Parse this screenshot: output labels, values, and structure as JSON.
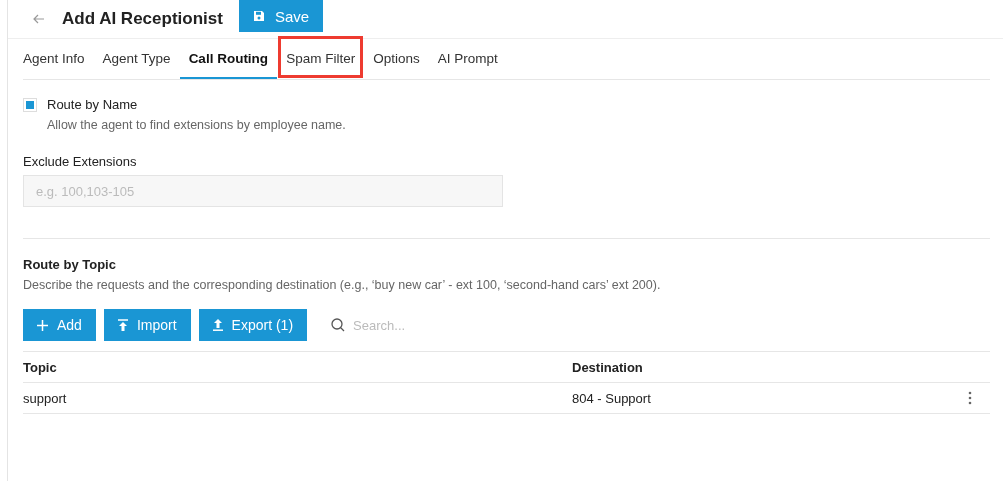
{
  "header": {
    "title": "Add AI Receptionist",
    "save_button": "Save"
  },
  "tabs": [
    {
      "label": "Agent Info",
      "selected": false,
      "highlighted": false
    },
    {
      "label": "Agent Type",
      "selected": false,
      "highlighted": false
    },
    {
      "label": "Call Routing",
      "selected": true,
      "highlighted": false
    },
    {
      "label": "Spam Filter",
      "selected": false,
      "highlighted": true
    },
    {
      "label": "Options",
      "selected": false,
      "highlighted": false
    },
    {
      "label": "AI Prompt",
      "selected": false,
      "highlighted": false
    }
  ],
  "route_by_name": {
    "label": "Route by Name",
    "checked": true,
    "description": "Allow the agent to find extensions by employee name."
  },
  "exclude_extensions": {
    "label": "Exclude Extensions",
    "placeholder": "e.g. 100,103-105"
  },
  "route_by_topic": {
    "title": "Route by Topic",
    "description": "Describe the requests and the corresponding destination (e.g., ‘buy new car’ - ext 100, ‘second-hand cars’ ext 200).",
    "buttons": [
      {
        "kind": "add",
        "label": "Add"
      },
      {
        "kind": "import",
        "label": "Import"
      },
      {
        "kind": "export",
        "label": "Export (1)"
      }
    ],
    "search": {
      "placeholder": "Search..."
    },
    "table": {
      "columns": [
        "Topic",
        "Destination"
      ],
      "rows": [
        {
          "topic": "support",
          "destination": "804 - Support"
        }
      ]
    }
  }
}
